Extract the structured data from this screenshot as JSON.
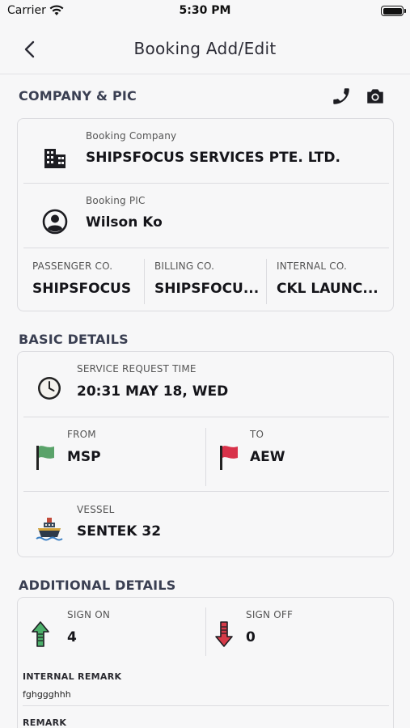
{
  "status_bar": {
    "carrier": "Carrier",
    "time": "5:30 PM"
  },
  "nav": {
    "title": "Booking Add/Edit"
  },
  "company_section": {
    "header": "COMPANY & PIC",
    "booking_company_label": "Booking Company",
    "booking_company_value": "SHIPSFOCUS SERVICES PTE. LTD.",
    "booking_pic_label": "Booking PIC",
    "booking_pic_value": "Wilson Ko",
    "passenger_co_label": "PASSENGER CO.",
    "passenger_co_value": "SHIPSFOCUS",
    "billing_co_label": "BILLING CO.",
    "billing_co_value": "SHIPSFOCU...",
    "internal_co_label": "INTERNAL CO.",
    "internal_co_value": "CKL LAUNC..."
  },
  "basic_section": {
    "header": "BASIC DETAILS",
    "service_time_label": "SERVICE REQUEST TIME",
    "service_time_value": "20:31 MAY 18, WED",
    "from_label": "FROM",
    "from_value": "MSP",
    "to_label": "TO",
    "to_value": "AEW",
    "vessel_label": "VESSEL",
    "vessel_value": "SENTEK 32"
  },
  "additional_section": {
    "header": "ADDITIONAL DETAILS",
    "sign_on_label": "SIGN ON",
    "sign_on_value": "4",
    "sign_off_label": "SIGN OFF",
    "sign_off_value": "0",
    "internal_remark_label": "INTERNAL REMARK",
    "internal_remark_value": "fghggghhh",
    "remark_label": "REMARK"
  },
  "colors": {
    "from_flag": "#5aa36a",
    "to_flag": "#d8324a",
    "sign_on_arrow": "#4caf6a",
    "sign_off_arrow": "#d63a48"
  },
  "icons": {
    "back": "chevron-left-icon",
    "phone": "phone-icon",
    "camera": "camera-icon",
    "company": "building-icon",
    "pic": "user-circle-icon",
    "time": "clock-icon",
    "from": "flag-icon",
    "to": "flag-icon",
    "vessel": "ship-icon",
    "sign_on": "arrow-up-icon",
    "sign_off": "arrow-down-icon"
  }
}
